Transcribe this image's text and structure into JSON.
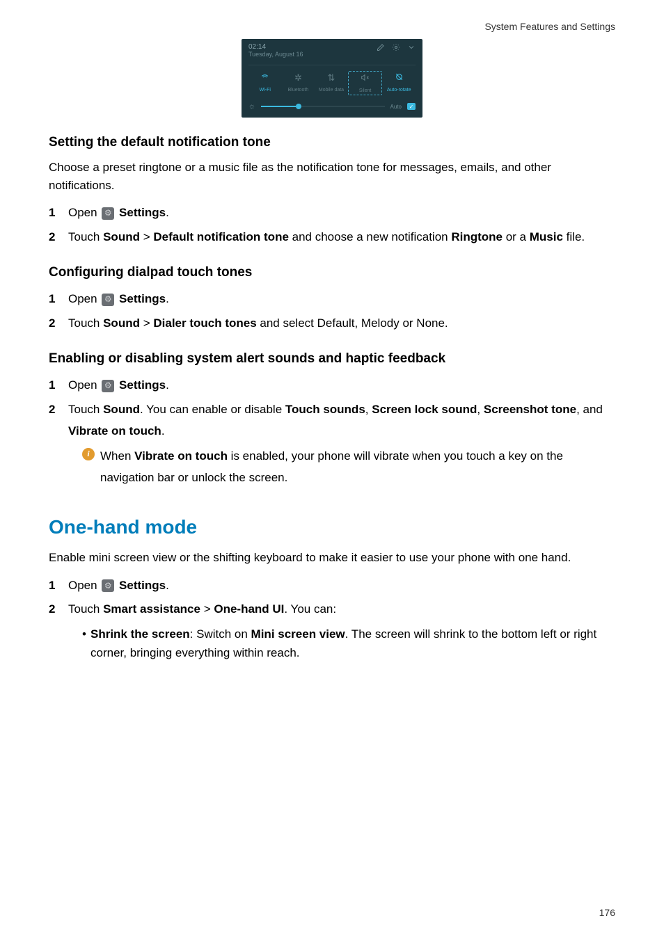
{
  "header": {
    "breadcrumb": "System Features and Settings"
  },
  "screenshot": {
    "time": "02:14",
    "date": "Tuesday, August 16",
    "tiles": {
      "wifi": "Wi-Fi",
      "bluetooth": "Bluetooth",
      "mobile_data": "Mobile data",
      "silent": "Silent",
      "auto_rotate": "Auto-rotate"
    },
    "brightness": {
      "auto_label": "Auto"
    }
  },
  "sec1": {
    "heading": "Setting the default notification tone",
    "intro": "Choose a preset ringtone or a music file as the notification tone for messages, emails, and other notifications.",
    "step1": {
      "open": "Open ",
      "settings": "Settings",
      "end": "."
    },
    "step2": {
      "touch": "Touch ",
      "b1": "Sound",
      "gt": " > ",
      "b2": "Default notification tone",
      "mid": " and choose a new notification ",
      "b3": "Ringtone",
      "or": " or a ",
      "b4": "Music",
      "end": " file."
    }
  },
  "sec2": {
    "heading": "Configuring dialpad touch tones",
    "step1": {
      "open": "Open ",
      "settings": "Settings",
      "end": "."
    },
    "step2": {
      "touch": "Touch ",
      "b1": "Sound",
      "gt": " > ",
      "b2": "Dialer touch tones",
      "end": " and select Default, Melody or None."
    }
  },
  "sec3": {
    "heading": "Enabling or disabling system alert sounds and haptic feedback",
    "step1": {
      "open": "Open ",
      "settings": "Settings",
      "end": "."
    },
    "step2": {
      "touch": "Touch ",
      "b1": "Sound",
      "mid1": ". You can enable or disable ",
      "b2": "Touch sounds",
      "c1": ", ",
      "b3": "Screen lock sound",
      "c2": ", ",
      "b4": "Screenshot tone",
      "c3": ", and ",
      "b5": "Vibrate on touch",
      "end": "."
    },
    "note": {
      "pre": "When ",
      "b": "Vibrate on touch",
      "post": " is enabled, your phone will vibrate when you touch a key on the navigation bar or unlock the screen."
    }
  },
  "sec4": {
    "heading": "One-hand mode",
    "intro": "Enable mini screen view or the shifting keyboard to make it easier to use your phone with one hand.",
    "step1": {
      "open": "Open ",
      "settings": "Settings",
      "end": "."
    },
    "step2": {
      "touch": "Touch ",
      "b1": "Smart assistance",
      "gt": " > ",
      "b2": "One-hand UI",
      "end": ". You can:"
    },
    "bullet1": {
      "b1": "Shrink the screen",
      "mid1": ": Switch on ",
      "b2": "Mini screen view",
      "end": ". The screen will shrink to the bottom left or right corner, bringing everything within reach."
    }
  },
  "page_number": "176"
}
